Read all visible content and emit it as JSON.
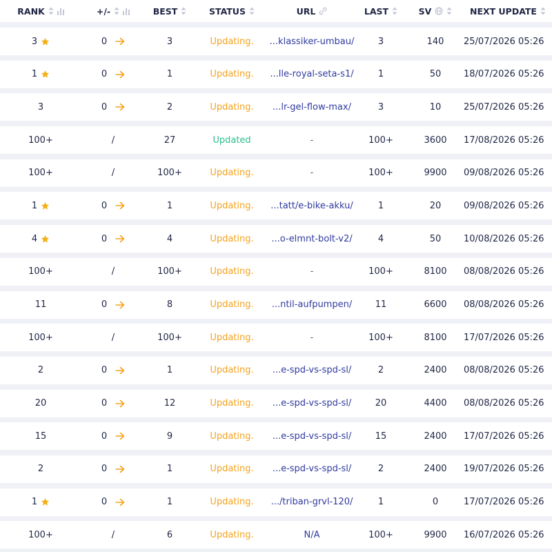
{
  "colors": {
    "updating": "#f5a21b",
    "updated": "#2bbf8a",
    "url": "#2f3a9e",
    "star": "#f5b014",
    "arrow": "#f5a21b"
  },
  "headers": {
    "rank": "RANK",
    "change": "+/-",
    "best": "BEST",
    "status": "STATUS",
    "url": "URL",
    "last": "LAST",
    "sv": "SV",
    "next_update": "NEXT UPDATE"
  },
  "rows": [
    {
      "rank": "3",
      "starred": true,
      "change": "0",
      "arrow": true,
      "best": "3",
      "status": "Updating.",
      "url": "...klassiker-umbau/",
      "last": "3",
      "sv": "140",
      "next_update": "25/07/2026 05:26"
    },
    {
      "rank": "1",
      "starred": true,
      "change": "0",
      "arrow": true,
      "best": "1",
      "status": "Updating.",
      "url": "...lle-royal-seta-s1/",
      "last": "1",
      "sv": "50",
      "next_update": "18/07/2026 05:26"
    },
    {
      "rank": "3",
      "starred": false,
      "change": "0",
      "arrow": true,
      "best": "2",
      "status": "Updating.",
      "url": "...lr-gel-flow-max/",
      "last": "3",
      "sv": "10",
      "next_update": "25/07/2026 05:26"
    },
    {
      "rank": "100+",
      "starred": false,
      "change": "/",
      "arrow": false,
      "best": "27",
      "status": "Updated",
      "url": "-",
      "last": "100+",
      "sv": "3600",
      "next_update": "17/08/2026 05:26"
    },
    {
      "rank": "100+",
      "starred": false,
      "change": "/",
      "arrow": false,
      "best": "100+",
      "status": "Updating.",
      "url": "-",
      "last": "100+",
      "sv": "9900",
      "next_update": "09/08/2026 05:26"
    },
    {
      "rank": "1",
      "starred": true,
      "change": "0",
      "arrow": true,
      "best": "1",
      "status": "Updating.",
      "url": "...tatt/e-bike-akku/",
      "last": "1",
      "sv": "20",
      "next_update": "09/08/2026 05:26"
    },
    {
      "rank": "4",
      "starred": true,
      "change": "0",
      "arrow": true,
      "best": "4",
      "status": "Updating.",
      "url": "...o-elmnt-bolt-v2/",
      "last": "4",
      "sv": "50",
      "next_update": "10/08/2026 05:26"
    },
    {
      "rank": "100+",
      "starred": false,
      "change": "/",
      "arrow": false,
      "best": "100+",
      "status": "Updating.",
      "url": "-",
      "last": "100+",
      "sv": "8100",
      "next_update": "08/08/2026 05:26"
    },
    {
      "rank": "11",
      "starred": false,
      "change": "0",
      "arrow": true,
      "best": "8",
      "status": "Updating.",
      "url": "...ntil-aufpumpen/",
      "last": "11",
      "sv": "6600",
      "next_update": "08/08/2026 05:26"
    },
    {
      "rank": "100+",
      "starred": false,
      "change": "/",
      "arrow": false,
      "best": "100+",
      "status": "Updating.",
      "url": "-",
      "last": "100+",
      "sv": "8100",
      "next_update": "17/07/2026 05:26"
    },
    {
      "rank": "2",
      "starred": false,
      "change": "0",
      "arrow": true,
      "best": "1",
      "status": "Updating.",
      "url": "...e-spd-vs-spd-sl/",
      "last": "2",
      "sv": "2400",
      "next_update": "08/08/2026 05:26"
    },
    {
      "rank": "20",
      "starred": false,
      "change": "0",
      "arrow": true,
      "best": "12",
      "status": "Updating.",
      "url": "...e-spd-vs-spd-sl/",
      "last": "20",
      "sv": "4400",
      "next_update": "08/08/2026 05:26"
    },
    {
      "rank": "15",
      "starred": false,
      "change": "0",
      "arrow": true,
      "best": "9",
      "status": "Updating.",
      "url": "...e-spd-vs-spd-sl/",
      "last": "15",
      "sv": "2400",
      "next_update": "17/07/2026 05:26"
    },
    {
      "rank": "2",
      "starred": false,
      "change": "0",
      "arrow": true,
      "best": "1",
      "status": "Updating.",
      "url": "...e-spd-vs-spd-sl/",
      "last": "2",
      "sv": "2400",
      "next_update": "19/07/2026 05:26"
    },
    {
      "rank": "1",
      "starred": true,
      "change": "0",
      "arrow": true,
      "best": "1",
      "status": "Updating.",
      "url": ".../triban-grvl-120/",
      "last": "1",
      "sv": "0",
      "next_update": "17/07/2026 05:26"
    },
    {
      "rank": "100+",
      "starred": false,
      "change": "/",
      "arrow": false,
      "best": "6",
      "status": "Updating.",
      "url": "N/A",
      "last": "100+",
      "sv": "9900",
      "next_update": "16/07/2026 05:26"
    }
  ]
}
